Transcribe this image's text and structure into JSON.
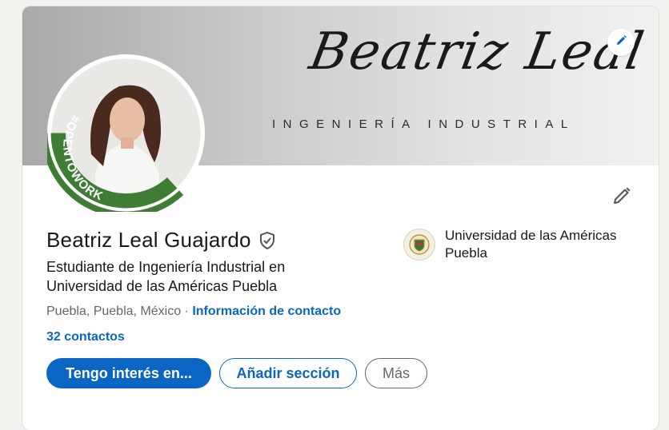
{
  "banner": {
    "script_name": "Beatriz Leal",
    "subtitle": "INGENIERÍA INDUSTRIAL",
    "edit_icon": "pencil-icon"
  },
  "avatar": {
    "badge_text": "#OPENTOWORK",
    "ring_color": "#3f7d35"
  },
  "profile": {
    "name": "Beatriz Leal Guajardo",
    "verify_icon": "shield-check-icon",
    "headline": "Estudiante de Ingeniería Industrial en Universidad de las Américas Puebla",
    "location": "Puebla, Puebla, México",
    "separator": " · ",
    "contact_link": "Información de contacto",
    "connections": "32 contactos",
    "edit_icon": "pencil-icon"
  },
  "school": {
    "name": "Universidad de las Américas Puebla",
    "logo_icon": "university-crest-icon"
  },
  "actions": {
    "primary": "Tengo interés en...",
    "secondary": "Añadir sección",
    "more": "Más"
  },
  "colors": {
    "accent": "#0a66c2",
    "text": "#191919",
    "muted": "#666666",
    "page_bg": "#f4f2ee"
  }
}
